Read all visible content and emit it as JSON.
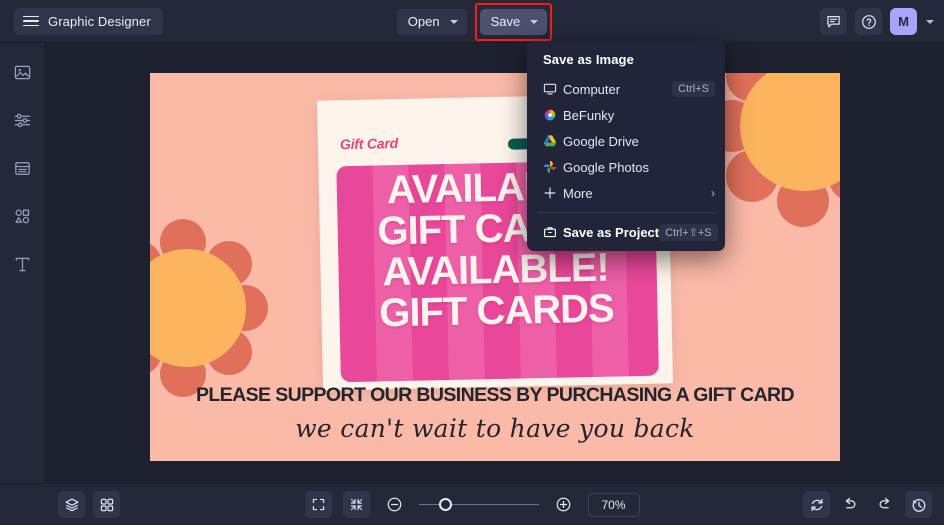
{
  "topbar": {
    "menu_icon": "hamburger-icon",
    "brand": "Graphic Designer",
    "open_button": "Open",
    "save_button": "Save",
    "feedback_icon": "chat-icon",
    "help_icon": "help-icon",
    "avatar_initial": "M"
  },
  "sidebar": {
    "items": [
      {
        "name": "image",
        "icon": "image-icon"
      },
      {
        "name": "adjust",
        "icon": "sliders-icon"
      },
      {
        "name": "templates",
        "icon": "template-icon"
      },
      {
        "name": "graphics",
        "icon": "shapes-icon"
      },
      {
        "name": "text",
        "icon": "text-icon"
      }
    ]
  },
  "dropdown": {
    "header": "Save as Image",
    "items": [
      {
        "label": "Computer",
        "shortcut": "Ctrl+S",
        "icon": "monitor-icon"
      },
      {
        "label": "BeFunky",
        "shortcut": "",
        "icon": "befunky-icon"
      },
      {
        "label": "Google Drive",
        "shortcut": "",
        "icon": "google-drive-icon"
      },
      {
        "label": "Google Photos",
        "shortcut": "",
        "icon": "google-photos-icon"
      },
      {
        "label": "More",
        "shortcut": "",
        "icon": "plus-icon",
        "submenu_arrow": "›"
      }
    ],
    "project": {
      "label": "Save as Project",
      "shortcut": "Ctrl+⇧+S",
      "icon": "briefcase-icon"
    }
  },
  "canvas": {
    "card_label": "Gift Card",
    "lines": [
      "AVAILABLE",
      "GIFT CARDS",
      "AVAILABLE!",
      "GIFT CARDS"
    ],
    "support_text": "PLEASE SUPPORT OUR BUSINESS BY PURCHASING A GIFT CARD",
    "script_text": "we can't wait to have you back",
    "colors": {
      "background": "#fbb9a8",
      "card": "#fdf4ec",
      "stripe_light": "#ed5fa7",
      "stripe_dark": "#e5338e",
      "flower_petal": "#e0705a",
      "flower_core": "#fbb55e",
      "hanger": "#0a5c52",
      "label_pink": "#e8456e"
    }
  },
  "bottombar": {
    "layers_icon": "layers-icon",
    "grid_icon": "grid-icon",
    "fullscreen_icon": "fullscreen-icon",
    "fit_icon": "fit-to-screen-icon",
    "zoom_out_icon": "zoom-out-icon",
    "zoom_in_icon": "zoom-in-icon",
    "zoom_level": "70%",
    "reset_icon": "reset-icon",
    "undo_icon": "undo-icon",
    "redo_icon": "redo-icon",
    "history_icon": "history-icon"
  },
  "accent": {
    "highlight_red": "#f91b1b",
    "save_bg": "#4d5170",
    "avatar_bg": "#a8a4fb"
  }
}
